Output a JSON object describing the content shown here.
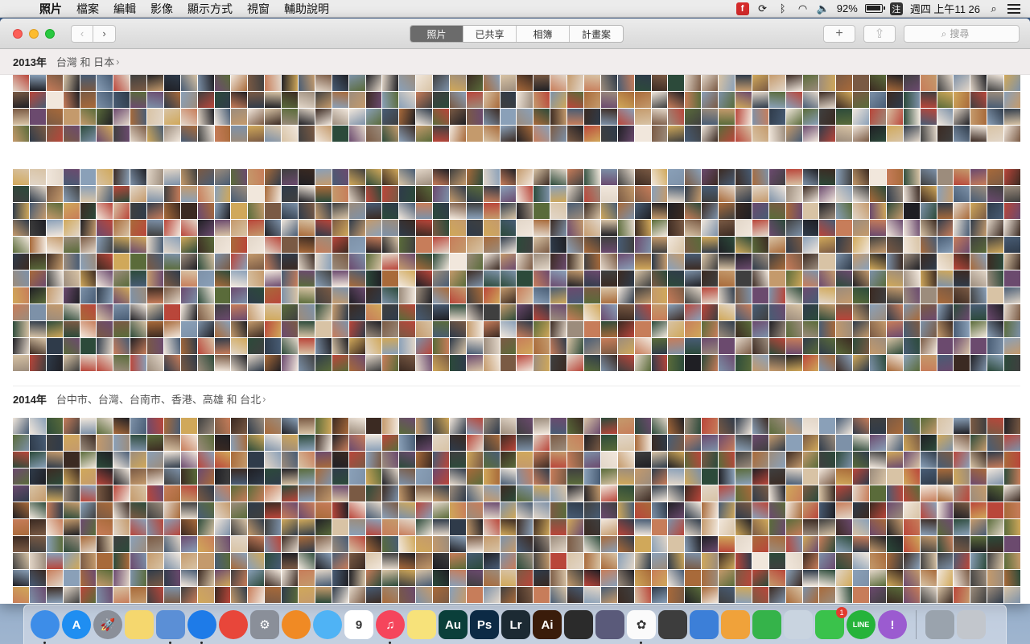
{
  "menubar": {
    "apple_icon": "apple-logo-icon",
    "items": [
      "照片",
      "檔案",
      "編輯",
      "影像",
      "顯示方式",
      "視窗",
      "輔助說明"
    ],
    "battery": "92%",
    "clock": "週四 上午11 26",
    "status_icons": [
      "flipboard-icon",
      "sync-icon",
      "bluetooth-icon",
      "wifi-icon",
      "volume-icon",
      "battery-icon",
      "input-method-icon",
      "search-icon",
      "list-icon"
    ],
    "input_method": "注",
    "flip_letter": "f"
  },
  "window": {
    "tabs": [
      {
        "label": "照片",
        "active": true
      },
      {
        "label": "已共享",
        "active": false
      },
      {
        "label": "相簿",
        "active": false
      },
      {
        "label": "計畫案",
        "active": false
      }
    ],
    "add_button": "+",
    "search": {
      "placeholder": "搜尋"
    }
  },
  "sections": [
    {
      "year": "2013年",
      "places": "台灣 和 日本"
    },
    {
      "year": "2014年",
      "places": "台中市、台灣、台南市、香港、高雄 和 台北"
    }
  ],
  "dock": {
    "apps": [
      {
        "name": "finder",
        "label": "",
        "color": "#3d8de8",
        "running": true
      },
      {
        "name": "app-store",
        "label": "A",
        "color": "#1f8ef1",
        "running": false
      },
      {
        "name": "launchpad",
        "label": "🚀",
        "color": "#8a8f99",
        "running": false
      },
      {
        "name": "stickies",
        "label": "",
        "color": "#f5d76e",
        "running": false
      },
      {
        "name": "preview",
        "label": "",
        "color": "#5b8fd6",
        "running": true
      },
      {
        "name": "safari",
        "label": "",
        "color": "#1e7be8",
        "running": true
      },
      {
        "name": "chrome",
        "label": "",
        "color": "#e8463a",
        "running": false
      },
      {
        "name": "system-preferences",
        "label": "⚙",
        "color": "#8a8f99",
        "running": false
      },
      {
        "name": "ibooks",
        "label": "",
        "color": "#f08a24",
        "running": false
      },
      {
        "name": "messages",
        "label": "",
        "color": "#4fb3f5",
        "running": false
      },
      {
        "name": "calendar",
        "label": "9",
        "color": "#ffffff",
        "running": false
      },
      {
        "name": "itunes",
        "label": "♫",
        "color": "#f5455c",
        "running": true
      },
      {
        "name": "notes",
        "label": "",
        "color": "#f7e27a",
        "running": false
      },
      {
        "name": "audition",
        "label": "Au",
        "color": "#0a3f3a",
        "running": false
      },
      {
        "name": "photoshop",
        "label": "Ps",
        "color": "#0c2a45",
        "running": false
      },
      {
        "name": "lightroom",
        "label": "Lr",
        "color": "#1c2a33",
        "running": false
      },
      {
        "name": "illustrator",
        "label": "Ai",
        "color": "#3a1c0a",
        "running": false
      },
      {
        "name": "final-cut",
        "label": "",
        "color": "#2b2b2b",
        "running": false
      },
      {
        "name": "motion",
        "label": "",
        "color": "#5a5a7a",
        "running": false
      },
      {
        "name": "photos",
        "label": "✿",
        "color": "#fbfbfb",
        "running": true
      },
      {
        "name": "garageband",
        "label": "",
        "color": "#3d3d3d",
        "running": false
      },
      {
        "name": "keynote",
        "label": "",
        "color": "#3c7fd8",
        "running": false
      },
      {
        "name": "pages",
        "label": "",
        "color": "#f0a23a",
        "running": false
      },
      {
        "name": "numbers",
        "label": "",
        "color": "#35b34a",
        "running": false
      },
      {
        "name": "preview-docs",
        "label": "",
        "color": "#c9d4e0",
        "running": false
      },
      {
        "name": "facetime",
        "label": "",
        "color": "#3ac24b",
        "running": false,
        "badge": "1"
      },
      {
        "name": "line",
        "label": "LINE",
        "color": "#25b33a",
        "running": false
      },
      {
        "name": "feedback",
        "label": "!",
        "color": "#9b5bd0",
        "running": false
      }
    ],
    "trailing": [
      {
        "name": "downloads-stack",
        "label": "",
        "color": "#9aa3ad"
      },
      {
        "name": "trash",
        "label": "",
        "color": "#c2c6cc"
      }
    ]
  }
}
